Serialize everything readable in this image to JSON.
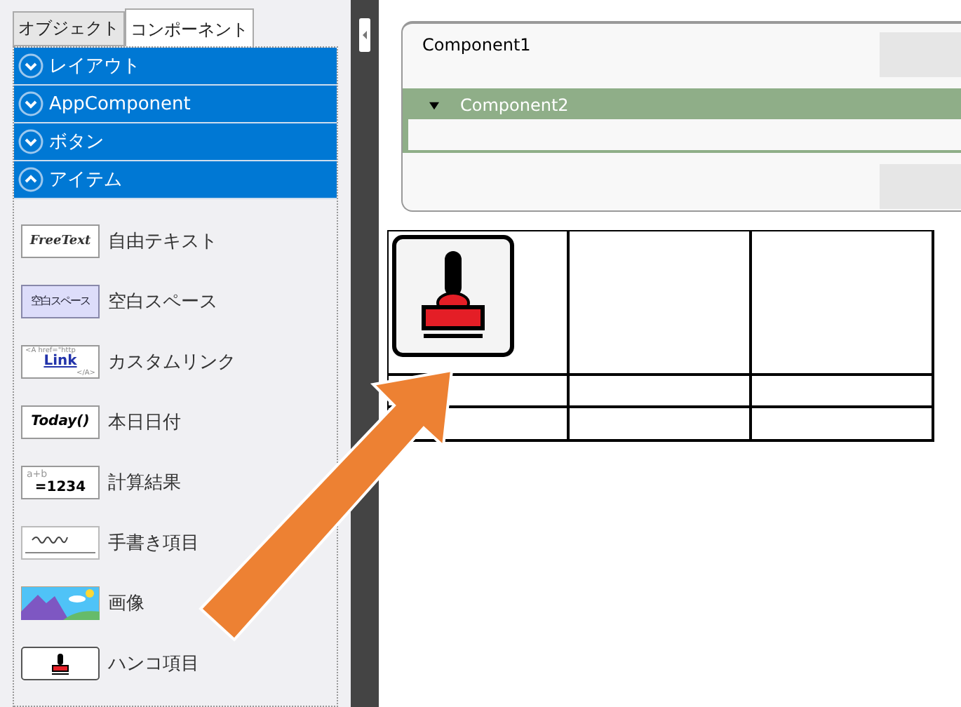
{
  "tabs": [
    {
      "label": "オブジェクト",
      "selected": false
    },
    {
      "label": "コンポーネント",
      "selected": true
    }
  ],
  "categories": [
    {
      "label": "レイアウト",
      "expanded": false
    },
    {
      "label": "AppComponent",
      "expanded": false
    },
    {
      "label": "ボタン",
      "expanded": false
    },
    {
      "label": "アイテム",
      "expanded": true
    }
  ],
  "items": [
    {
      "kind": "freetext",
      "label": "自由テキスト",
      "icon_texts": [
        "FreeText"
      ]
    },
    {
      "kind": "space",
      "label": "空白スペース",
      "icon_texts": [
        "空白スペース"
      ]
    },
    {
      "kind": "link",
      "label": "カスタムリンク",
      "icon_texts": [
        "<A href=\"http",
        "Link",
        "</A>"
      ]
    },
    {
      "kind": "today",
      "label": "本日日付",
      "icon_texts": [
        "Today()"
      ]
    },
    {
      "kind": "calc",
      "label": "計算結果",
      "icon_texts": [
        "a+b",
        "=1234"
      ]
    },
    {
      "kind": "handwriting",
      "label": "手書き項目"
    },
    {
      "kind": "image",
      "label": "画像"
    },
    {
      "kind": "stamp",
      "label": "ハンコ項目"
    }
  ],
  "canvas": {
    "component1": "Component1",
    "component2": {
      "label": "Component2",
      "expanded": true
    }
  }
}
